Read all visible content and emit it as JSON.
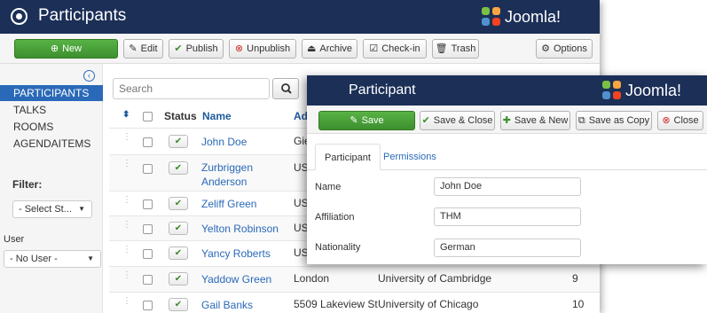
{
  "back": {
    "title": "Participants",
    "brand": "Joomla!",
    "toolbar": {
      "new": "New",
      "edit": "Edit",
      "publish": "Publish",
      "unpublish": "Unpublish",
      "archive": "Archive",
      "checkin": "Check-in",
      "trash": "Trash",
      "options": "Options"
    },
    "sidebar": {
      "items": [
        "PARTICIPANTS",
        "TALKS",
        "ROOMS",
        "AGENDAITEMS"
      ],
      "active": "PARTICIPANTS",
      "filter_label": "Filter:",
      "status_select": "- Select St...",
      "user_label": "User",
      "user_select": "- No User -"
    },
    "search": {
      "placeholder": "Search"
    },
    "table": {
      "headers": {
        "status": "Status",
        "name": "Name",
        "address": "Ad"
      },
      "rows": [
        {
          "name": "John Doe",
          "address": "Gie",
          "affiliation": "",
          "count": ""
        },
        {
          "name": "Zurbriggen Anderson",
          "address": "US",
          "affiliation": "",
          "count": ""
        },
        {
          "name": "Zeliff Green",
          "address": "USA",
          "affiliation": "",
          "count": ""
        },
        {
          "name": "Yelton Robinson",
          "address": "USA",
          "affiliation": "",
          "count": ""
        },
        {
          "name": "Yancy Roberts",
          "address": "USA",
          "affiliation": "",
          "count": ""
        },
        {
          "name": "Yaddow Green",
          "address": "London",
          "affiliation": "University of Cambridge",
          "count": "9"
        },
        {
          "name": "Gail Banks",
          "address": "5509 Lakeview St",
          "affiliation": "University of Chicago",
          "count": "10"
        }
      ]
    }
  },
  "front": {
    "title": "Participant",
    "brand": "Joomla!",
    "toolbar": {
      "save": "Save",
      "save_close": "Save & Close",
      "save_new": "Save & New",
      "save_copy": "Save as Copy",
      "close": "Close"
    },
    "tabs": [
      "Participant",
      "Permissions"
    ],
    "fields": [
      {
        "label": "Name",
        "value": "John Doe"
      },
      {
        "label": "Affiliation",
        "value": "THM"
      },
      {
        "label": "Nationality",
        "value": "German"
      }
    ]
  },
  "colors": {
    "header_bg": "#1b2f57",
    "accent": "#2a69b8",
    "success": "#3d8f2f",
    "danger": "#c9302c"
  }
}
